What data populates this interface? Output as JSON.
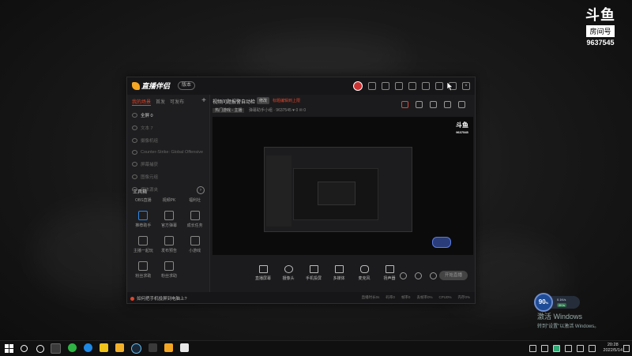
{
  "desktop": {
    "room_badge": {
      "logo": "斗鱼",
      "label": "房间号",
      "number": "9637545"
    },
    "activate_windows": {
      "title": "激活 Windows",
      "subtitle": "转到\"设置\"以激活 Windows。"
    },
    "net_widget": {
      "percent": "90",
      "percent_unit": "%",
      "up": "0.1K/s",
      "down": "0K/s"
    }
  },
  "app": {
    "name": "直播伴侣",
    "version_label": "版本",
    "sidebar": {
      "tabs": [
        "我的场景",
        "首发",
        "可发布"
      ],
      "scenes": [
        {
          "label": "全屏 0",
          "active": true
        },
        {
          "label": "文本 7",
          "active": false
        },
        {
          "label": "摄像机组",
          "active": false
        },
        {
          "label": "Counter-Strike: Global Offensive",
          "active": false
        },
        {
          "label": "屏幕捕获",
          "active": false
        },
        {
          "label": "图像元组",
          "active": false
        },
        {
          "label": "媒体源夹",
          "active": false
        }
      ],
      "tools_title": "工具箱",
      "tools": [
        {
          "label": "OBS直播"
        },
        {
          "label": "视频PK"
        },
        {
          "label": "福利社"
        },
        {
          "label": "推荐助手"
        },
        {
          "label": "官方弹幕"
        },
        {
          "label": "成长任务"
        },
        {
          "label": "主播一起玩"
        },
        {
          "label": "发布预告"
        },
        {
          "label": "小游戏"
        },
        {
          "label": "粉丝求助"
        },
        {
          "label": "粉丝求助"
        }
      ]
    },
    "header": {
      "title": "视频问题报警自动检",
      "edit": "修改",
      "warning": "标题编辑到上限",
      "category": "热门游戏 - 主播",
      "meta": "弹幕助手小组 · 9637545",
      "likes": "0",
      "comments": "0"
    },
    "preview": {
      "room_logo": "斗鱼",
      "room_number": "9637545"
    },
    "toolbar": [
      {
        "label": "直播屏幕"
      },
      {
        "label": "摄像头"
      },
      {
        "label": "手机投屏"
      },
      {
        "label": "多媒体"
      },
      {
        "label": "麦克风"
      },
      {
        "label": "扬声器"
      }
    ],
    "go_live": "开始直播",
    "status": {
      "notice": "如何把手机投屏到电脑上?",
      "stats": [
        "直播时长0s",
        "码率0",
        "帧率0",
        "丢帧率0%",
        "CPU0%",
        "内存0%"
      ]
    }
  },
  "taskbar": {
    "time": "20:28",
    "date": "2022/5/14"
  },
  "colors": {
    "accent": "#e0452b",
    "brand": "#f5a623"
  }
}
